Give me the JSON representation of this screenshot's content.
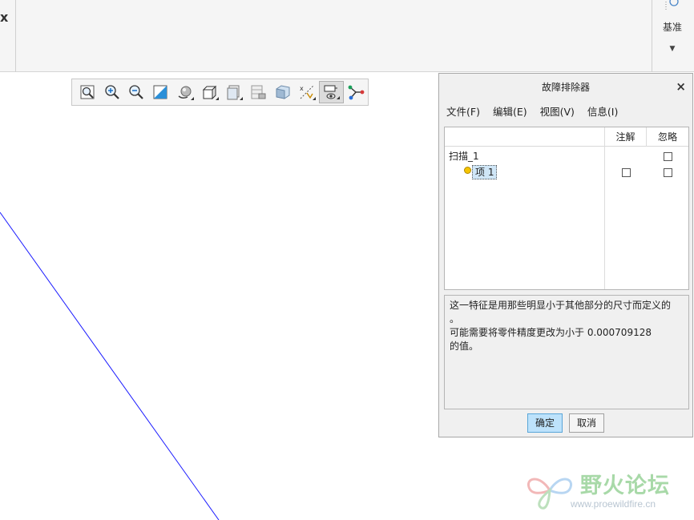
{
  "ribbon": {
    "close_glyph": "x",
    "datum_label": "基准",
    "datum_dropdown": "▼"
  },
  "toolbar": {
    "buttons": [
      {
        "icon": "refit-icon"
      },
      {
        "icon": "zoom-in-icon"
      },
      {
        "icon": "zoom-out-icon"
      },
      {
        "icon": "repaint-icon"
      },
      {
        "icon": "spin-center-icon"
      },
      {
        "icon": "saved-orientations-icon"
      },
      {
        "icon": "named-views-icon"
      },
      {
        "icon": "view-manager-icon"
      },
      {
        "icon": "display-style-icon"
      },
      {
        "icon": "datum-display-icon"
      },
      {
        "icon": "annotation-display-icon"
      },
      {
        "icon": "spin-axis-icon"
      }
    ]
  },
  "dialog": {
    "title": "故障排除器",
    "close_glyph": "×",
    "menu": [
      "文件(F)",
      "编辑(E)",
      "视图(V)",
      "信息(I)"
    ],
    "columns": {
      "annotation": "注解",
      "ignore": "忽略"
    },
    "tree": {
      "feature": "扫描_1",
      "item": "项 1"
    },
    "message_lines": [
      "这一特征是用那些明显小于其他部分的尺寸而定义的",
      "。",
      "可能需要将零件精度更改为小于 0.000709128",
      "的值。"
    ],
    "ok_label": "确定",
    "cancel_label": "取消"
  },
  "watermark": {
    "text": "野火论坛",
    "url": "www.proewildfire.cn"
  },
  "colors": {
    "sketch_line": "#1a1aff",
    "ok_button": "#bde2fb"
  }
}
